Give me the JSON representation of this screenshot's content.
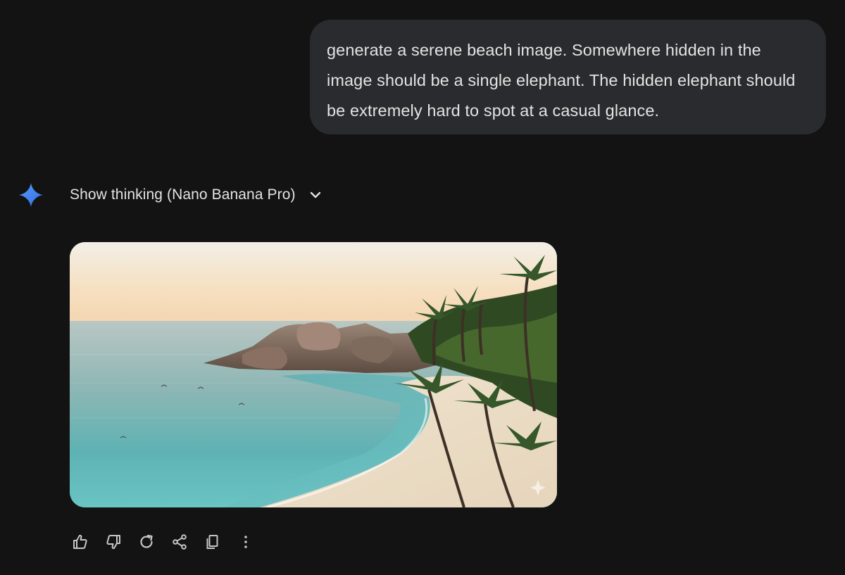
{
  "conversation": {
    "user_message": "generate a serene beach image. Somewhere hidden in the image should be a single elephant. The hidden elephant should be extremely hard to spot at a casual glance.",
    "response": {
      "thinking_label": "Show thinking (Nano Banana Pro)",
      "image_description_alt": "",
      "actions": [
        {
          "icon": "thumbs-up-icon"
        },
        {
          "icon": "thumbs-down-icon"
        },
        {
          "icon": "regenerate-icon"
        },
        {
          "icon": "share-icon"
        },
        {
          "icon": "copy-icon"
        },
        {
          "icon": "more-options-icon"
        }
      ]
    }
  },
  "colors": {
    "background": "#131314",
    "bubble": "#2a2b2e",
    "text": "#e3e3e3",
    "icon": "#c4c7c5",
    "spark_gradient": [
      "#4f8df7",
      "#3a6fe0"
    ]
  }
}
